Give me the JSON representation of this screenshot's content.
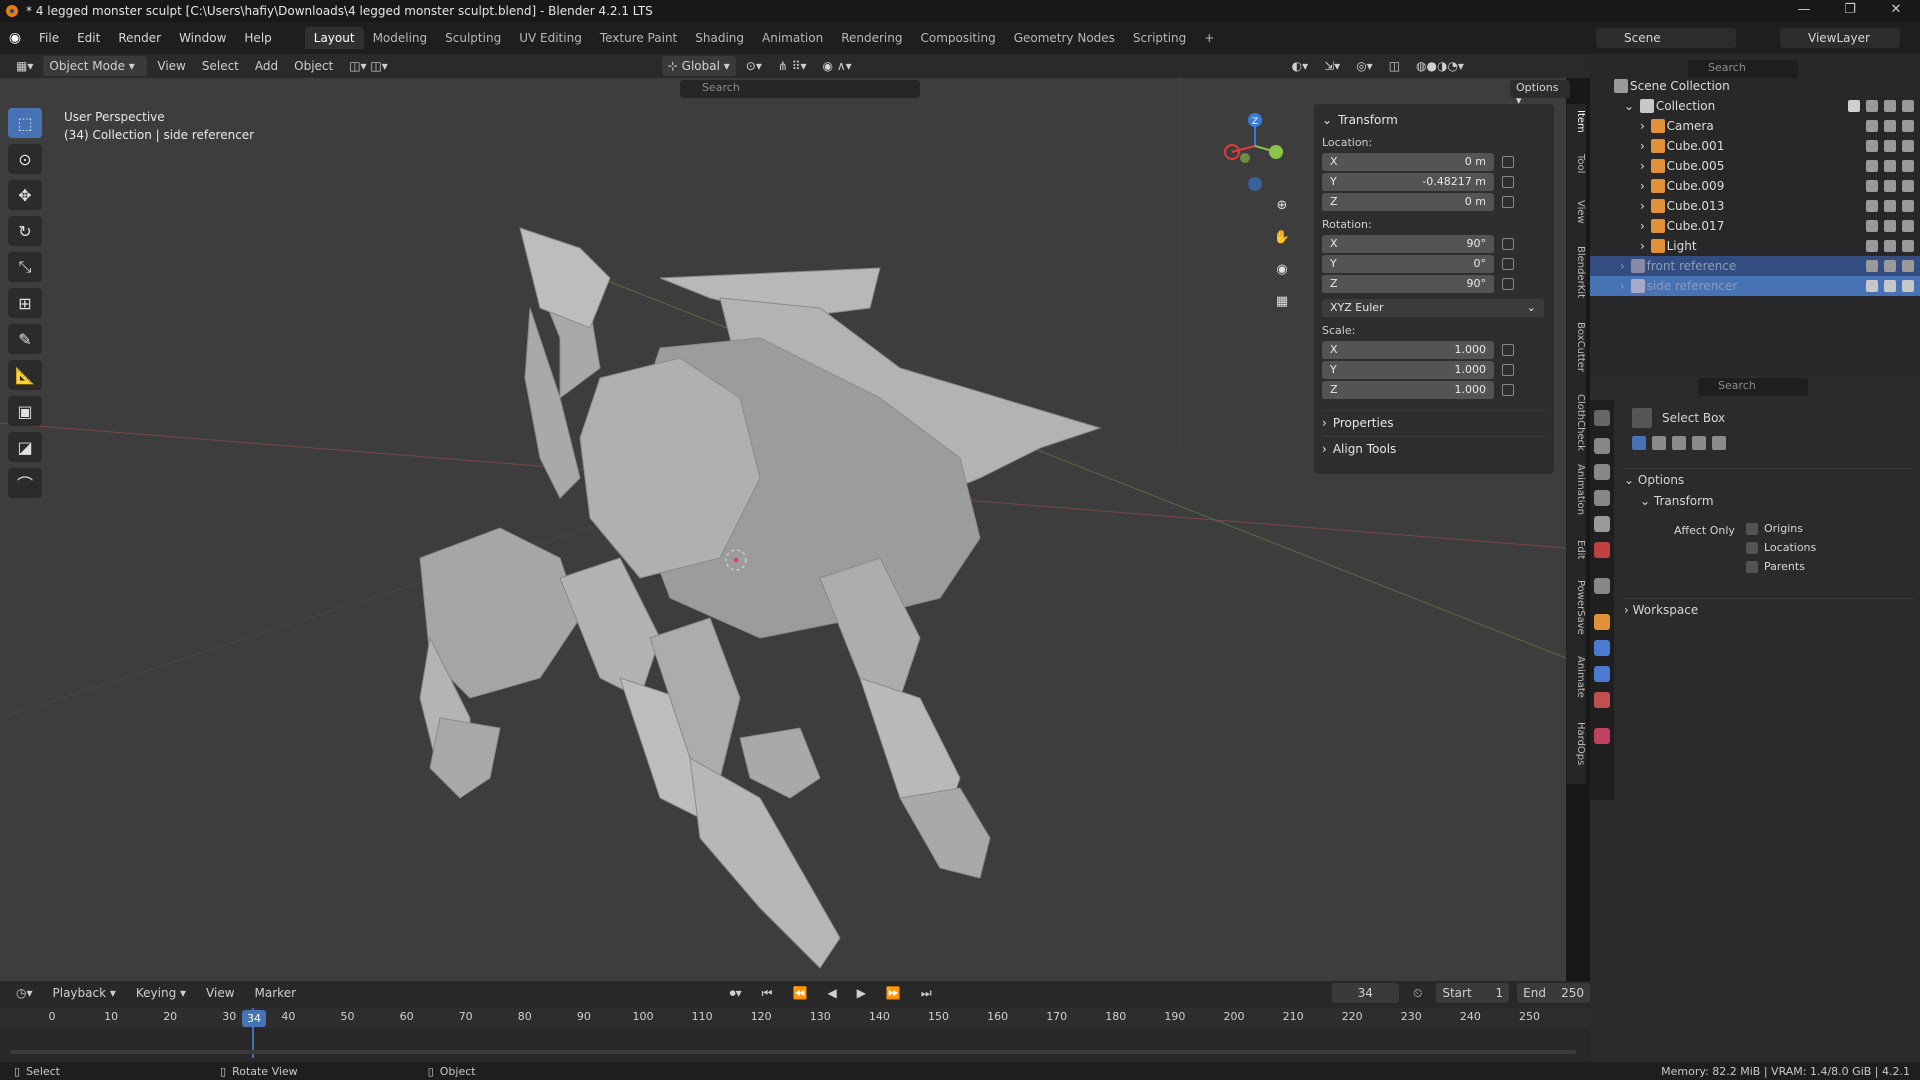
{
  "window": {
    "title": "* 4 legged monster sculpt [C:\\Users\\hafiy\\Downloads\\4 legged monster sculpt.blend] - Blender 4.2.1 LTS"
  },
  "menu": {
    "items": [
      "File",
      "Edit",
      "Render",
      "Window",
      "Help"
    ],
    "workspaces": [
      "Layout",
      "Modeling",
      "Sculpting",
      "UV Editing",
      "Texture Paint",
      "Shading",
      "Animation",
      "Rendering",
      "Compositing",
      "Geometry Nodes",
      "Scripting",
      "+"
    ],
    "scene_label": "Scene",
    "viewlayer_label": "ViewLayer"
  },
  "viewport_header": {
    "mode": "Object Mode",
    "menus": [
      "View",
      "Select",
      "Add",
      "Object"
    ],
    "orientation": "Global",
    "search_placeholder": "Search",
    "options_label": "Options"
  },
  "viewport": {
    "perspective": "User Perspective",
    "collection_info": "(34) Collection | side referencer"
  },
  "npanel": {
    "transform_title": "Transform",
    "location_label": "Location:",
    "location": [
      {
        "axis": "X",
        "value": "0 m"
      },
      {
        "axis": "Y",
        "value": "-0.48217 m"
      },
      {
        "axis": "Z",
        "value": "0 m"
      }
    ],
    "rotation_label": "Rotation:",
    "rotation": [
      {
        "axis": "X",
        "value": "90°"
      },
      {
        "axis": "Y",
        "value": "0°"
      },
      {
        "axis": "Z",
        "value": "90°"
      }
    ],
    "rotation_mode": "XYZ Euler",
    "scale_label": "Scale:",
    "scale": [
      {
        "axis": "X",
        "value": "1.000"
      },
      {
        "axis": "Y",
        "value": "1.000"
      },
      {
        "axis": "Z",
        "value": "1.000"
      }
    ],
    "properties_label": "Properties",
    "align_tools_label": "Align Tools",
    "tabs": [
      "Item",
      "Tool",
      "View",
      "BlenderKit",
      "BoxCutter",
      "ClothCheck",
      "Animation",
      "Edit",
      "PowerSave",
      "Animate",
      "HardOps"
    ]
  },
  "timeline": {
    "menus": [
      "Playback",
      "Keying",
      "View",
      "Marker"
    ],
    "current_frame": "34",
    "start_label": "Start",
    "start": "1",
    "end_label": "End",
    "end": "250",
    "ticks": [
      "0",
      "10",
      "20",
      "30",
      "40",
      "50",
      "60",
      "70",
      "80",
      "90",
      "100",
      "110",
      "120",
      "130",
      "140",
      "150",
      "160",
      "170",
      "180",
      "190",
      "200",
      "210",
      "220",
      "230",
      "240",
      "250"
    ]
  },
  "outliner": {
    "search_placeholder": "Search",
    "root": "Scene Collection",
    "collection": "Collection",
    "items": [
      {
        "name": "Camera"
      },
      {
        "name": "Cube.001"
      },
      {
        "name": "Cube.005"
      },
      {
        "name": "Cube.009"
      },
      {
        "name": "Cube.013"
      },
      {
        "name": "Cube.017"
      },
      {
        "name": "Light"
      },
      {
        "name": "front reference"
      },
      {
        "name": "side referencer"
      }
    ]
  },
  "properties": {
    "search_placeholder": "Search",
    "tool_name": "Select Box",
    "options_label": "Options",
    "transform_label": "Transform",
    "affect_only_label": "Affect Only",
    "checkboxes": [
      "Origins",
      "Locations",
      "Parents"
    ],
    "workspace_label": "Workspace"
  },
  "status": {
    "select": "Select",
    "rotate": "Rotate View",
    "object": "Object",
    "memory": "Memory: 82.2 MiB | VRAM: 1.4/8.0 GiB | 4.2.1"
  },
  "colors": {
    "accent": "#4772b3",
    "axis_x": "#e23b3b",
    "axis_y": "#8bc34a",
    "axis_z": "#3b7bd8"
  }
}
